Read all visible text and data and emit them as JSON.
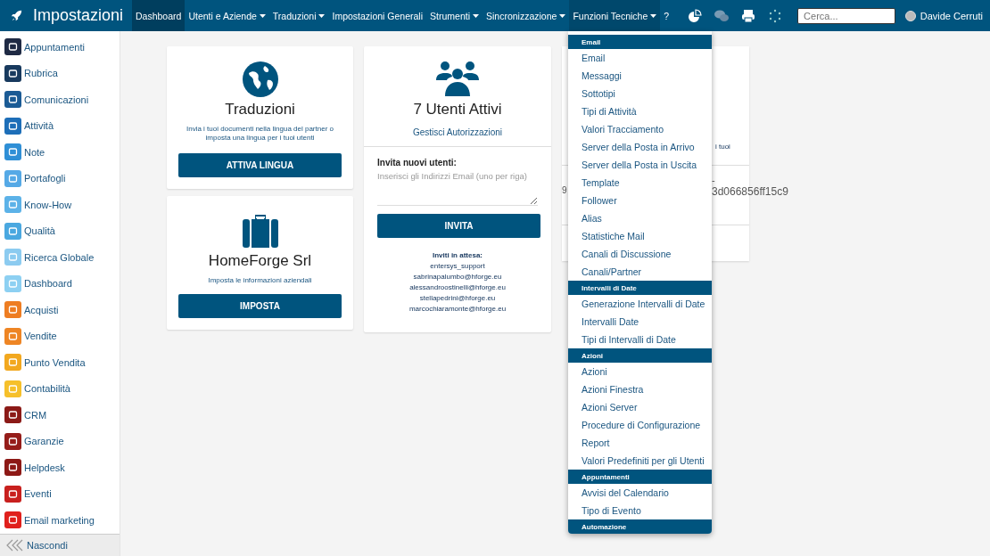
{
  "app": {
    "title": "Impostazioni"
  },
  "nav": [
    {
      "label": "Dashboard",
      "has_menu": false,
      "selected": true,
      "open": false
    },
    {
      "label": "Utenti e Aziende",
      "has_menu": true,
      "selected": false,
      "open": false
    },
    {
      "label": "Traduzioni",
      "has_menu": true,
      "selected": false,
      "open": false
    },
    {
      "label": "Impostazioni Generali",
      "has_menu": false,
      "selected": false,
      "open": false
    },
    {
      "label": "Strumenti",
      "has_menu": true,
      "selected": false,
      "open": false
    },
    {
      "label": "Sincronizzazione",
      "has_menu": true,
      "selected": false,
      "open": false
    },
    {
      "label": "Funzioni Tecniche",
      "has_menu": true,
      "selected": false,
      "open": true
    },
    {
      "label": "?",
      "has_menu": false,
      "selected": false,
      "open": false
    }
  ],
  "search": {
    "placeholder": "Cerca..."
  },
  "user": {
    "name": "Davide Cerruti"
  },
  "sidebar": {
    "items": [
      {
        "label": "Appuntamenti",
        "color": "#1f2a44"
      },
      {
        "label": "Rubrica",
        "color": "#183a5e"
      },
      {
        "label": "Comunicazioni",
        "color": "#1b5b95"
      },
      {
        "label": "Attività",
        "color": "#1d6eb8"
      },
      {
        "label": "Note",
        "color": "#2f8fd6"
      },
      {
        "label": "Portafogli",
        "color": "#55a9e6"
      },
      {
        "label": "Know-How",
        "color": "#5cb2e8"
      },
      {
        "label": "Qualità",
        "color": "#4aa8e0"
      },
      {
        "label": "Ricerca Globale",
        "color": "#8ccbf0"
      },
      {
        "label": "Dashboard",
        "color": "#8dd0f2"
      },
      {
        "label": "Acquisti",
        "color": "#ee7d22"
      },
      {
        "label": "Vendite",
        "color": "#ee8524"
      },
      {
        "label": "Punto Vendita",
        "color": "#f2a81f"
      },
      {
        "label": "Contabilità",
        "color": "#f6c02a"
      },
      {
        "label": "CRM",
        "color": "#8b1a17"
      },
      {
        "label": "Garanzie",
        "color": "#951d1a"
      },
      {
        "label": "Helpdesk",
        "color": "#8d1916"
      },
      {
        "label": "Eventi",
        "color": "#c8201e"
      },
      {
        "label": "Email marketing",
        "color": "#e0201c"
      }
    ],
    "collapse": "Nascondi"
  },
  "cards": {
    "translations": {
      "title": "Traduzioni",
      "description": "Invia i tuoi documenti nella lingua del partner o imposta una lingua per i tuoi utenti",
      "button": "ATTIVA LINGUA"
    },
    "company": {
      "title": "HomeForge Srl",
      "description": "Imposta le informazioni aziendali",
      "button": "IMPOSTA"
    },
    "users": {
      "title": "7 Utenti Attivi",
      "link": "Gestisci Autorizzazioni",
      "invite_label": "Invita nuovi utenti:",
      "invite_placeholder": "Inserisci gli Indirizzi Email (uno per riga)",
      "button": "INVITA",
      "pending_heading": "Inviti in attesa:",
      "pending": [
        "entersys_support",
        "sabrinapalumbo@hforge.eu",
        "alessandroostinelli@hforge.eu",
        "stellapedrini@hforge.eu",
        "marcochiaramonte@hforge.eu"
      ]
    },
    "partial": {
      "text_1": "i tuoi",
      "text_2": "-",
      "text_3": "9",
      "text_4": "3d066856ff15c9"
    }
  },
  "dropdown": {
    "sections": [
      {
        "heading": "Email",
        "items": [
          "Email",
          "Messaggi",
          "Sottotipi",
          "Tipi di Attività",
          "Valori Tracciamento",
          "Server della Posta in Arrivo",
          "Server della Posta in Uscita",
          "Template",
          "Follower",
          "Alias",
          "Statistiche Mail",
          "Canali di Discussione",
          "Canali/Partner"
        ]
      },
      {
        "heading": "Intervalli di Date",
        "items": [
          "Generazione Intervalli di Date",
          "Intervalli Date",
          "Tipi di Intervalli di Date"
        ]
      },
      {
        "heading": "Azioni",
        "items": [
          "Azioni",
          "Azioni Finestra",
          "Azioni Server",
          "Procedure di Configurazione",
          "Report",
          "Valori Predefiniti per gli Utenti"
        ]
      },
      {
        "heading": "Appuntamenti",
        "items": [
          "Avvisi del Calendario",
          "Tipo di Evento"
        ]
      },
      {
        "heading": "Automazione"
      }
    ]
  }
}
